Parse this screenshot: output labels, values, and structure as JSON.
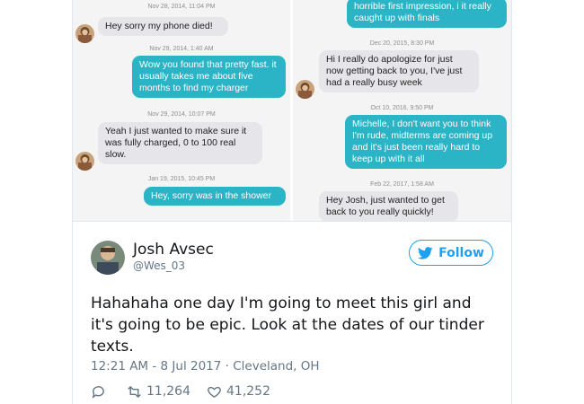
{
  "colors": {
    "accent": "#1da1f2",
    "bubble_out": "#2bb3c6",
    "bubble_in": "#e5e5ea"
  },
  "left_panel": {
    "messages": [
      {
        "timestamp": "Nov 28, 2014, 11:04 PM",
        "text": "Hey sorry my phone died!",
        "direction": "in"
      },
      {
        "timestamp": "Nov 29, 2014, 1:40 AM",
        "text": "Wow you found that pretty fast. it usually takes me about  five months to find my charger",
        "direction": "out"
      },
      {
        "timestamp": "Nov 29, 2014, 10:07 PM",
        "text": "Yeah I just wanted to make sure it was fully charged, 0 to 100 real slow.",
        "direction": "in"
      },
      {
        "timestamp": "Jan 19, 2015, 10:45 PM",
        "text": "Hey, sorry was in the shower",
        "direction": "out"
      }
    ]
  },
  "right_panel": {
    "messages": [
      {
        "timestamp": "",
        "text": "horrible first impression, i it really caught up with finals",
        "direction": "out"
      },
      {
        "timestamp": "Dec 20, 2015, 8:30 PM",
        "text": "Hi I really do apologize for just now getting back to you, I've just had a really busy week",
        "direction": "in"
      },
      {
        "timestamp": "Oct 10, 2016, 9:50 PM",
        "text": "Michelle, I don't want you to think I'm rude, midterms are coming up and it's just been really hard to keep up with it all",
        "direction": "out"
      },
      {
        "timestamp": "Feb 22, 2017, 1:58 AM",
        "text": "Hey Josh, just wanted to get back to you really quickly!",
        "direction": "in"
      }
    ]
  },
  "tweet": {
    "author_name": "Josh Avsec",
    "author_handle": "@Wes_03",
    "follow_label": "Follow",
    "text": "Hahahaha one day I'm going to meet this girl and it's going to be epic. Look at the dates of our tinder texts.",
    "time": "12:21 AM - 8 Jul 2017",
    "location": "Cleveland, OH",
    "meta_separator": " · ",
    "retweets": "11,264",
    "likes": "41,252"
  },
  "icons": {
    "follow": "twitter-bird-icon",
    "reply": "reply-icon",
    "retweet": "retweet-icon",
    "like": "heart-icon"
  }
}
